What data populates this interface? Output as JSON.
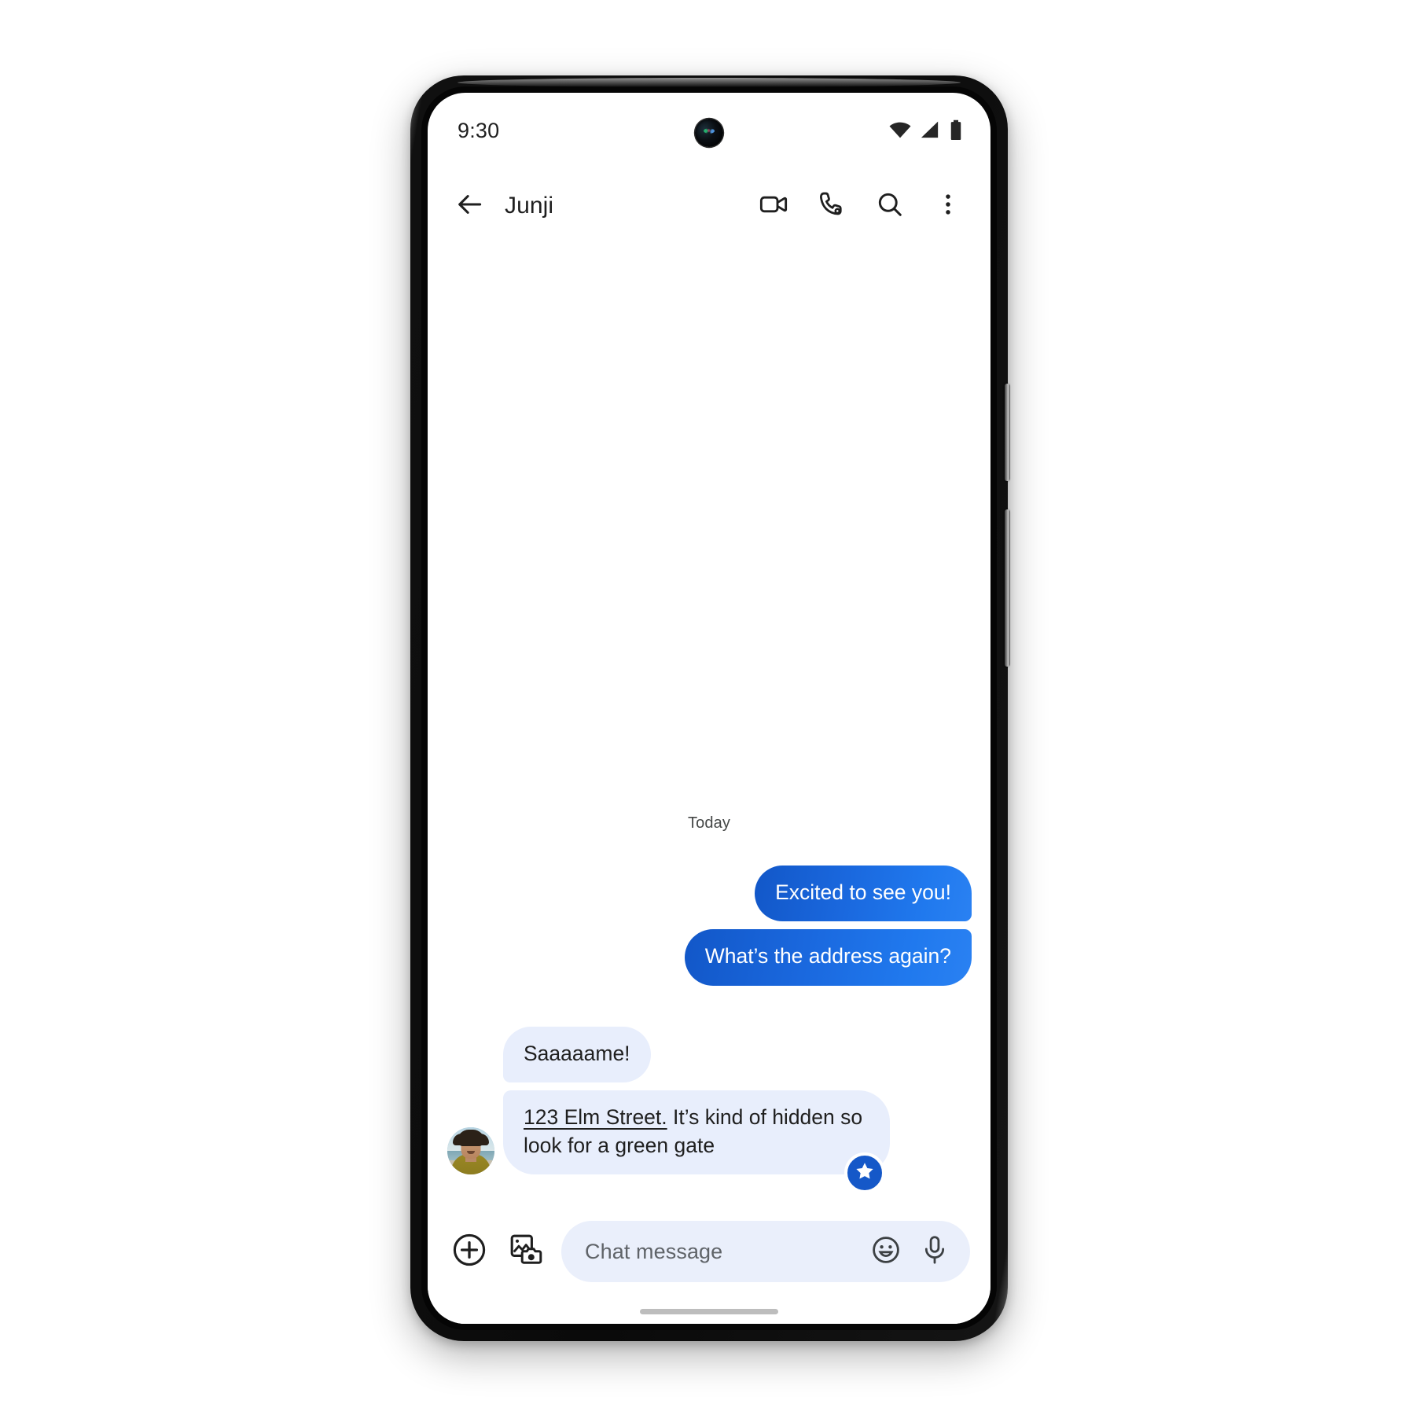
{
  "device": {
    "type": "android-phone",
    "side_buttons": [
      "power-button",
      "volume-rocker"
    ]
  },
  "status_bar": {
    "time": "9:30",
    "icons": [
      "wifi-icon",
      "cellular-signal-icon",
      "battery-icon"
    ],
    "camera": "front-camera-punch-hole"
  },
  "app_bar": {
    "back_label": "",
    "title": "Junji",
    "actions": [
      {
        "name": "video-call-icon",
        "label": ""
      },
      {
        "name": "voice-call-icon",
        "label": ""
      },
      {
        "name": "search-icon",
        "label": ""
      },
      {
        "name": "overflow-menu-icon",
        "label": ""
      }
    ]
  },
  "thread": {
    "date_divider": "Today",
    "messages": [
      {
        "id": "m1",
        "direction": "outgoing",
        "text": "Excited to see you!",
        "position": "first"
      },
      {
        "id": "m2",
        "direction": "outgoing",
        "text": "What’s the address again?",
        "position": "last"
      },
      {
        "id": "m3",
        "direction": "incoming",
        "text": "Saaaaame!",
        "position": "first"
      },
      {
        "id": "m4",
        "direction": "incoming",
        "link_text": "123 Elm Street.",
        "text": " It’s kind of hidden so look for a green gate",
        "position": "last",
        "has_avatar": true,
        "reaction": "star-reaction-badge"
      }
    ]
  },
  "compose": {
    "add_label": "",
    "gallery_label": "",
    "placeholder": "Chat message",
    "value": "",
    "emoji_label": "",
    "mic_label": ""
  },
  "colors": {
    "outgoing_bubble_start": "#1257c8",
    "outgoing_bubble_end": "#2a81f2",
    "incoming_bubble": "#e8eefc",
    "input_field": "#eaeffb",
    "reaction_badge": "#1558c8",
    "text_primary": "#1f1f1f",
    "text_secondary": "#5f6368"
  }
}
